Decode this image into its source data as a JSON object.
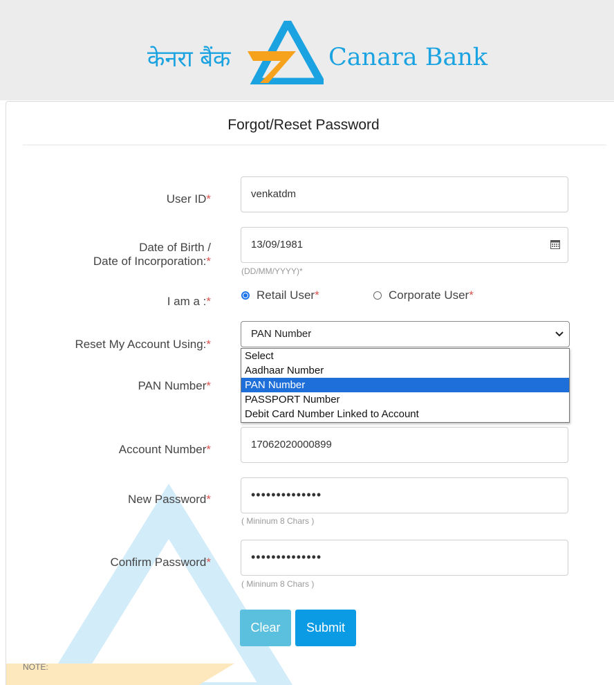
{
  "brand": {
    "hindi_name": "केनरा बैंक",
    "english_name": "Canara Bank",
    "colors": {
      "blue": "#1aa3e0",
      "orange": "#f6a21c"
    }
  },
  "form": {
    "title": "Forgot/Reset Password",
    "required_mark": "*",
    "user_id": {
      "label": "User ID",
      "value": "venkatdm"
    },
    "dob": {
      "label_line1": "Date of Birth /",
      "label_line2": "Date of Incorporation:",
      "value": "13/09/1981",
      "hint": "(DD/MM/YYYY)*",
      "icon": "calendar-icon"
    },
    "user_type": {
      "label": "I am a :",
      "options": [
        {
          "label": "Retail User",
          "selected": true
        },
        {
          "label": "Corporate User",
          "selected": false
        }
      ]
    },
    "reset_using": {
      "label": "Reset My Account Using:",
      "selected": "PAN Number",
      "options": [
        "Select",
        "Aadhaar Number",
        "PAN Number",
        "PASSPORT Number",
        "Debit Card Number Linked to Account"
      ],
      "highlighted_index": 2
    },
    "pan": {
      "label": "PAN Number"
    },
    "account": {
      "label": "Account Number",
      "value": "17062020000899"
    },
    "new_password": {
      "label": "New Password",
      "value": "••••••••••••••",
      "hint": "( Mininum 8 Chars )"
    },
    "confirm_password": {
      "label": "Confirm Password",
      "value": "••••••••••••••",
      "hint": "( Mininum 8 Chars )"
    },
    "buttons": {
      "clear": "Clear",
      "submit": "Submit"
    },
    "note_label": "NOTE:"
  }
}
